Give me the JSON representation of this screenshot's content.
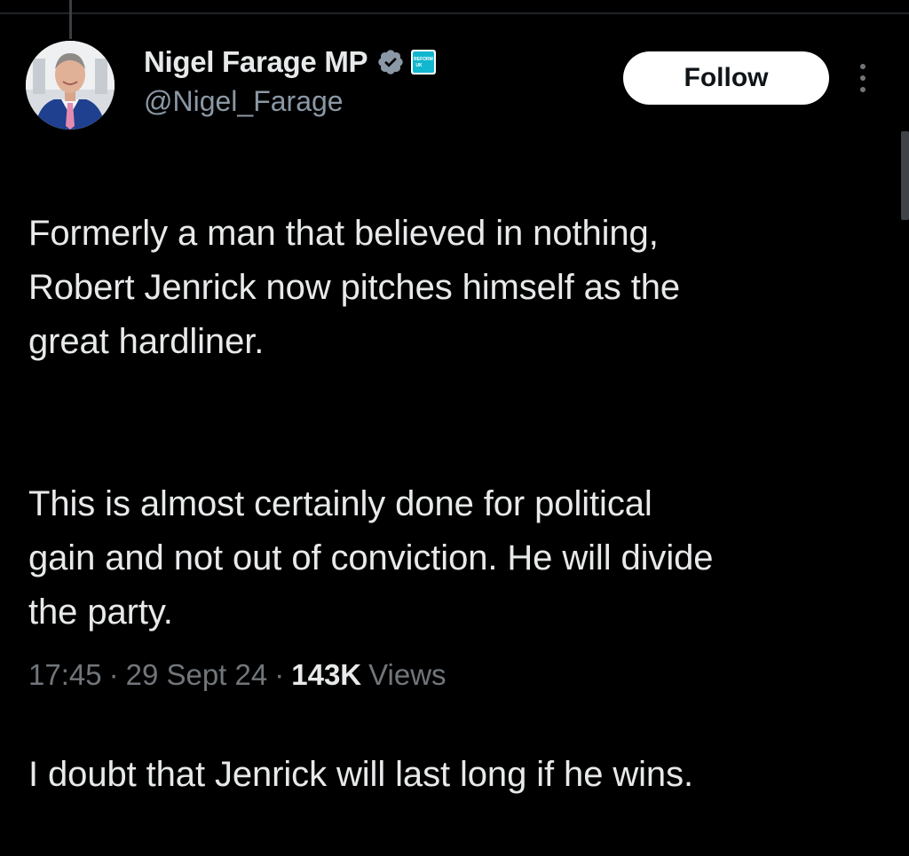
{
  "author": {
    "display_name": "Nigel Farage MP",
    "handle": "@Nigel_Farage",
    "avatar": "profile-photo",
    "verified_icon": "verified-badge-icon",
    "affiliate_badge": "reform-uk-badge",
    "affiliate_badge_text": "REFORM UK"
  },
  "actions": {
    "follow_label": "Follow",
    "more_icon": "more-vertical-icon"
  },
  "tweet": {
    "paragraphs": [
      "Formerly a man that believed in nothing,\nRobert Jenrick now pitches himself as the\ngreat hardliner.",
      "This is almost certainly done for political\ngain and not out of conviction. He will divide\nthe party.",
      "I doubt that Jenrick will last long if he wins."
    ]
  },
  "meta": {
    "time": "17:45",
    "separator": "·",
    "date": "29 Sept 24",
    "views_count": "143K",
    "views_label": "Views"
  },
  "colors": {
    "background": "#000000",
    "text_primary": "#e7e9ea",
    "text_secondary": "#71767b",
    "verified_badge": "#8b98a5",
    "follow_bg": "#ffffff",
    "affiliate_badge": "#12b6cf"
  }
}
